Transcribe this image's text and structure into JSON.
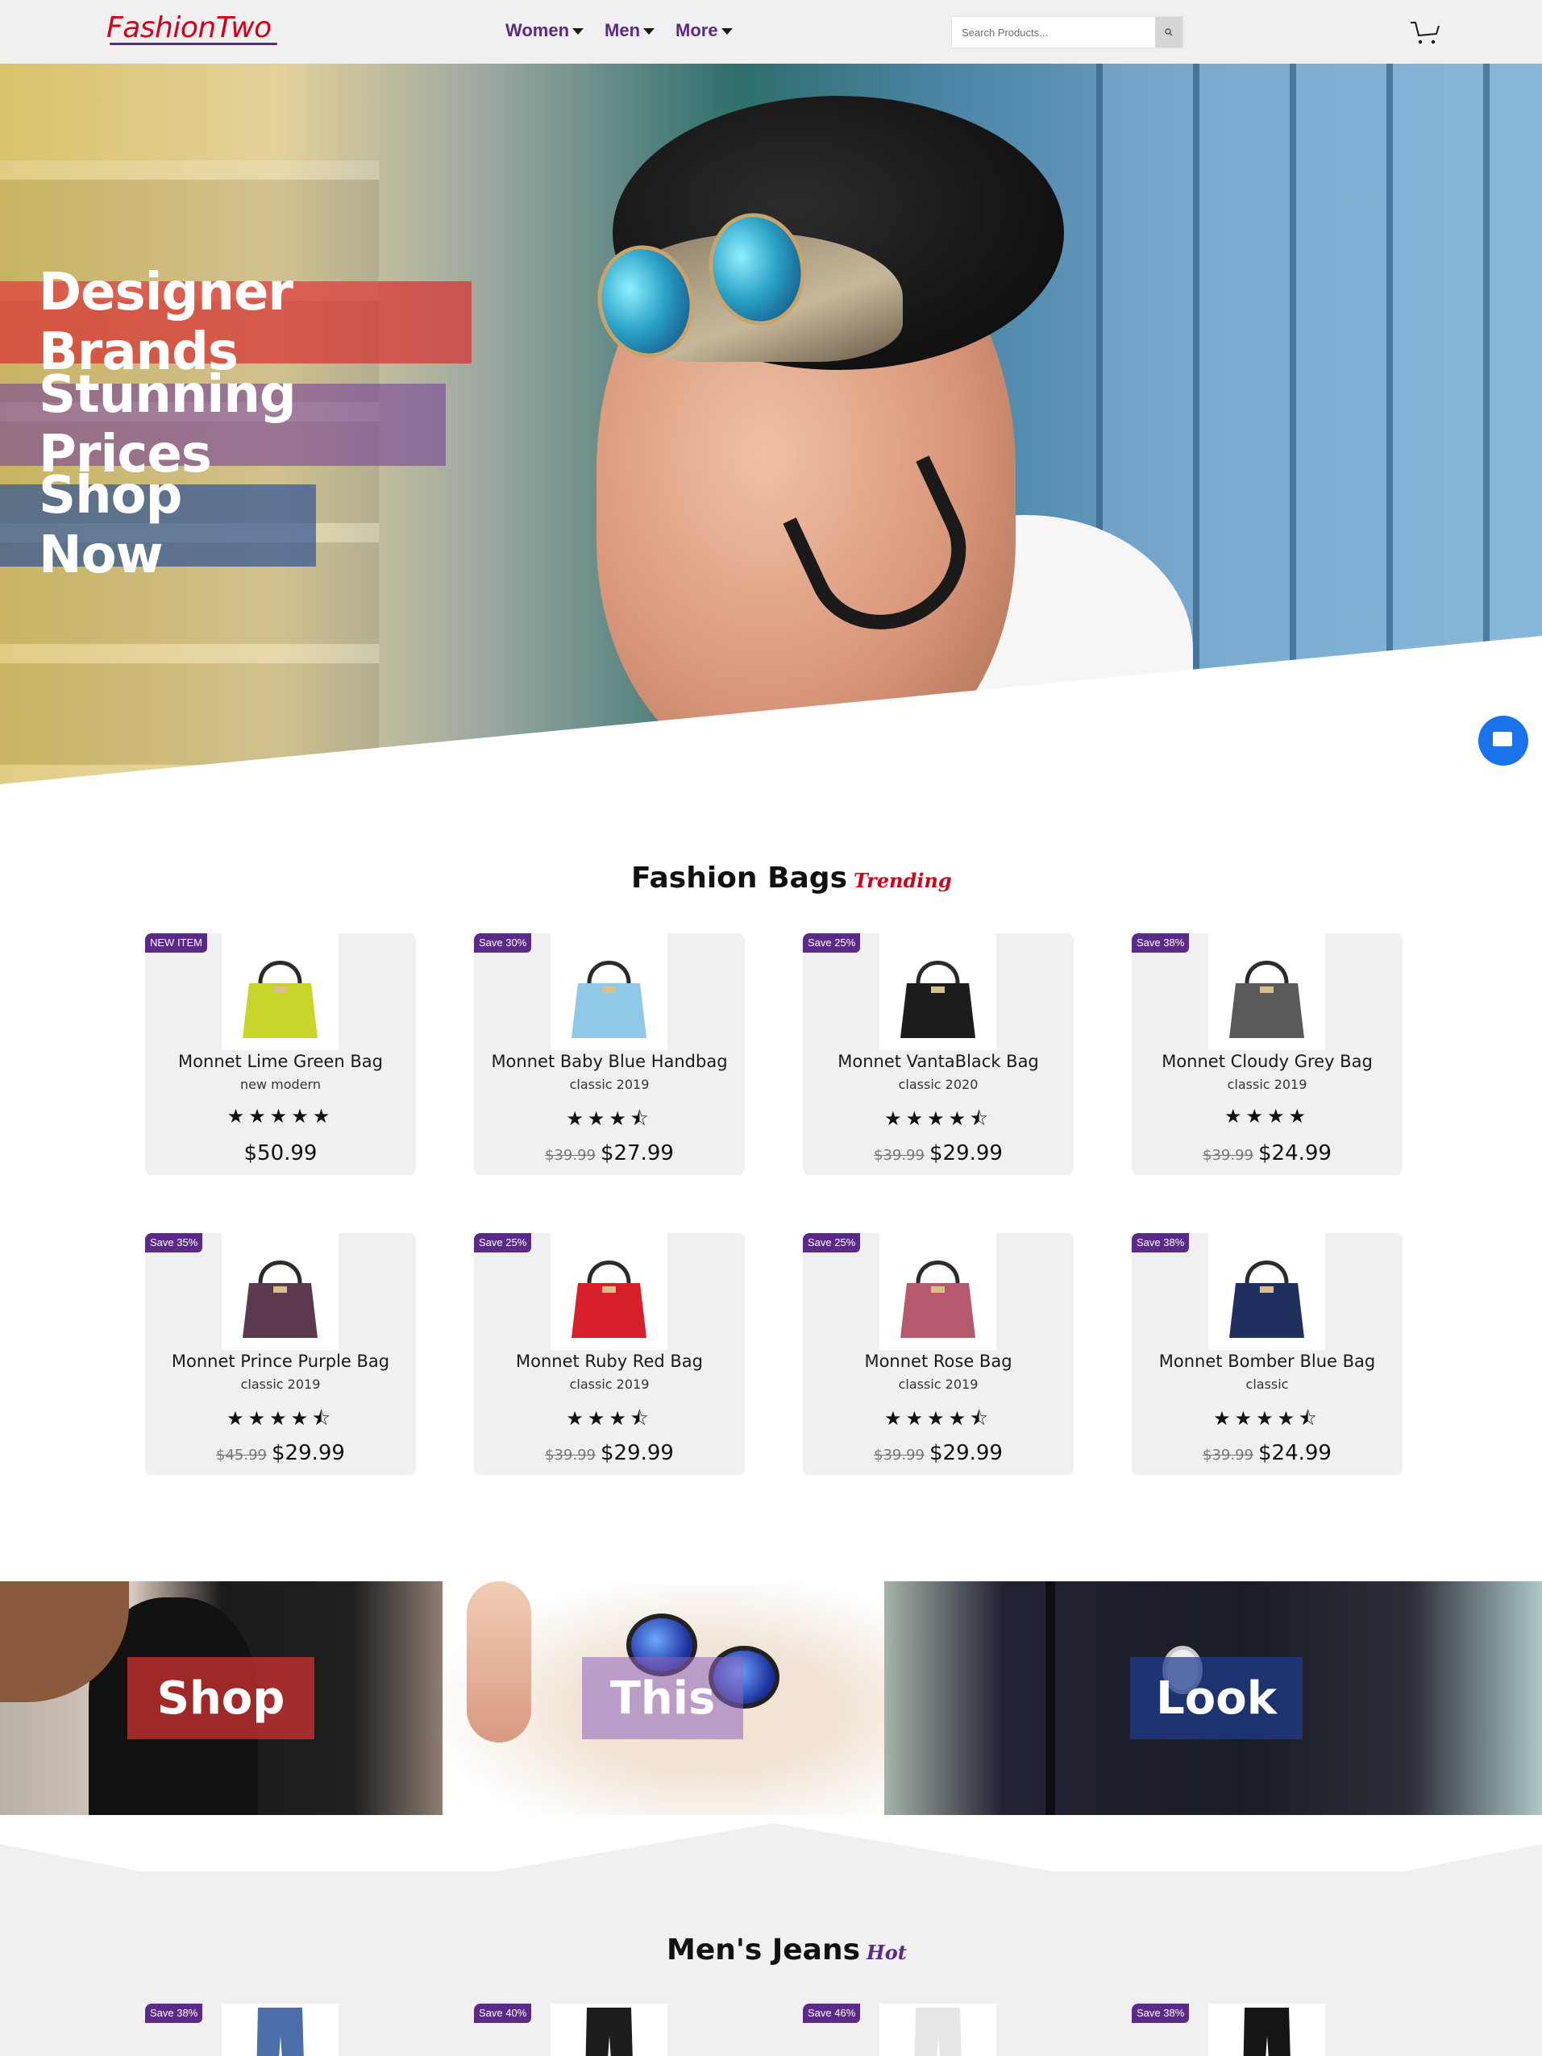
{
  "nav": {
    "logo_fashion": "Fashion",
    "logo_two": "Two",
    "menu": [
      {
        "label": "Women"
      },
      {
        "label": "Men"
      },
      {
        "label": "More"
      }
    ],
    "search_placeholder": "Search Products...",
    "search_icon": "search-icon",
    "cart_icon": "cart-icon"
  },
  "hero": {
    "line1": "Designer Brands",
    "line2": "Stunning Prices",
    "line3": "Shop Now"
  },
  "bags": {
    "title": "Fashion Bags",
    "tag": "Trending",
    "items": [
      {
        "badge": "NEW ITEM",
        "name": "Monnet Lime Green Bag",
        "sub": "new modern",
        "stars": "★★★★★",
        "old_price": "",
        "price": "$50.99",
        "color": "#c8d62b"
      },
      {
        "badge": "Save 30%",
        "name": "Monnet Baby Blue Handbag",
        "sub": "classic 2019",
        "stars": "★★★⯪",
        "old_price": "$39.99",
        "price": "$27.99",
        "color": "#8ec9e8"
      },
      {
        "badge": "Save 25%",
        "name": "Monnet VantaBlack Bag",
        "sub": "classic 2020",
        "stars": "★★★★⯪",
        "old_price": "$39.99",
        "price": "$29.99",
        "color": "#1c1c1c"
      },
      {
        "badge": "Save 38%",
        "name": "Monnet Cloudy Grey Bag",
        "sub": "classic 2019",
        "stars": "★★★★",
        "old_price": "$39.99",
        "price": "$24.99",
        "color": "#5a5a5a"
      },
      {
        "badge": "Save 35%",
        "name": "Monnet Prince Purple Bag",
        "sub": "classic 2019",
        "stars": "★★★★⯪",
        "old_price": "$45.99",
        "price": "$29.99",
        "color": "#5b3a4e"
      },
      {
        "badge": "Save 25%",
        "name": "Monnet Ruby Red Bag",
        "sub": "classic 2019",
        "stars": "★★★⯪",
        "old_price": "$39.99",
        "price": "$29.99",
        "color": "#d61f2a"
      },
      {
        "badge": "Save 25%",
        "name": "Monnet Rose Bag",
        "sub": "classic 2019",
        "stars": "★★★★⯪",
        "old_price": "$39.99",
        "price": "$29.99",
        "color": "#b55a6e"
      },
      {
        "badge": "Save 38%",
        "name": "Monnet Bomber Blue Bag",
        "sub": "classic",
        "stars": "★★★★⯪",
        "old_price": "$39.99",
        "price": "$24.99",
        "color": "#1f2f5e"
      }
    ]
  },
  "look": {
    "word1": "Shop",
    "word2": "This",
    "word3": "Look"
  },
  "jeans": {
    "title": "Men's Jeans",
    "tag": "Hot",
    "items": [
      {
        "badge": "Save 38%",
        "color": "#4a6ea8"
      },
      {
        "badge": "Save 40%",
        "color": "#1c1c1c"
      },
      {
        "badge": "Save 46%",
        "color": "#e6e6e6"
      },
      {
        "badge": "Save 38%",
        "color": "#151515"
      }
    ]
  },
  "colors": {
    "brand_red": "#d0021b",
    "brand_purple": "#5b2a86",
    "chat_blue": "#1a73e8"
  }
}
